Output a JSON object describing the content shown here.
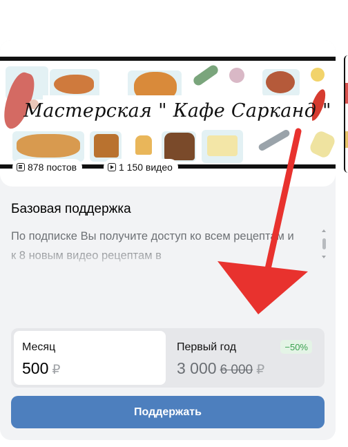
{
  "cover": {
    "banner_text": "Мастерская \" Кафе Сарканд \"",
    "chips": [
      {
        "icon": "posts-icon",
        "label": "878 постов"
      },
      {
        "icon": "video-icon",
        "label": "1 150 видео"
      }
    ]
  },
  "tier": {
    "title": "Базовая поддержка",
    "description": "По подписке Вы получите доступ ко всем рецептам и к 8 новым видео рецептам в"
  },
  "period": {
    "month": {
      "label": "Месяц",
      "price": "500",
      "currency": "₽",
      "selected": true
    },
    "year": {
      "label": "Первый год",
      "price": "3 000",
      "old_price": "6 000",
      "currency": "₽",
      "discount": "−50%"
    }
  },
  "cta": {
    "label": "Поддержать"
  },
  "colors": {
    "accent": "#4d7fbe",
    "discount_text": "#3aa14f",
    "arrow": "#e8322e"
  }
}
